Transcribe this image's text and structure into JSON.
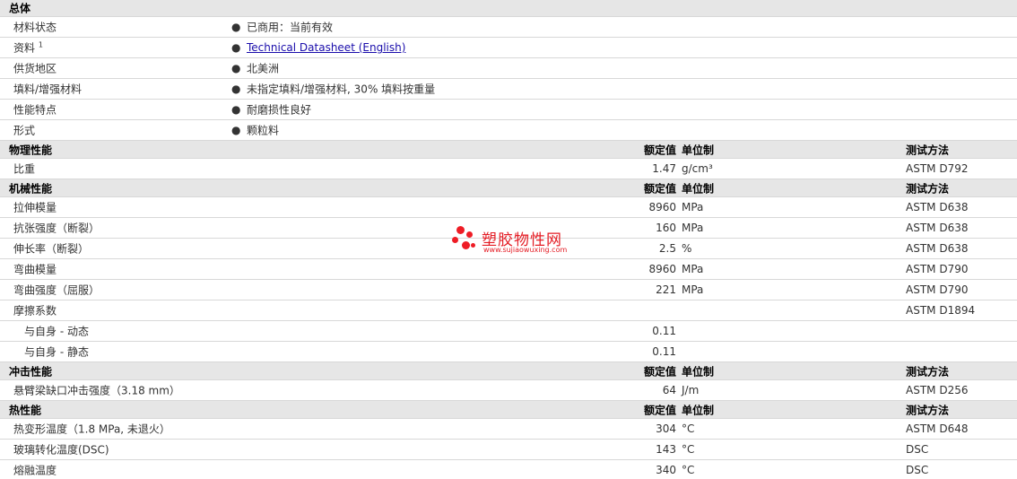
{
  "general": {
    "title": "总体",
    "rows": [
      {
        "label": "材料状态",
        "value": "已商用：当前有效"
      },
      {
        "label": "资料",
        "sup": "1",
        "value": "Technical Datasheet (English)"
      },
      {
        "label": "供货地区",
        "value": "北美洲"
      },
      {
        "label": "填料/增强材料",
        "value": "未指定填料/增强材料, 30% 填料按重量"
      },
      {
        "label": "性能特点",
        "value": "耐磨损性良好"
      },
      {
        "label": "形式",
        "value": "颗粒料"
      }
    ]
  },
  "columns": {
    "nominal": "额定值",
    "unit": "单位制",
    "method": "测试方法"
  },
  "physical": {
    "title": "物理性能",
    "rows": [
      {
        "label": "比重",
        "value": "1.47",
        "unit": "g/cm³",
        "method": "ASTM D792"
      }
    ]
  },
  "mechanical": {
    "title": "机械性能",
    "rows": [
      {
        "label": "拉伸模量",
        "value": "8960",
        "unit": "MPa",
        "method": "ASTM D638"
      },
      {
        "label": "抗张强度（断裂）",
        "value": "160",
        "unit": "MPa",
        "method": "ASTM D638"
      },
      {
        "label": "伸长率（断裂）",
        "value": "2.5",
        "unit": "%",
        "method": "ASTM D638"
      },
      {
        "label": "弯曲模量",
        "value": "8960",
        "unit": "MPa",
        "method": "ASTM D790"
      },
      {
        "label": "弯曲强度（屈服）",
        "value": "221",
        "unit": "MPa",
        "method": "ASTM D790"
      },
      {
        "label": "摩擦系数",
        "value": "",
        "unit": "",
        "method": "ASTM D1894"
      },
      {
        "label": "与自身 - 动态",
        "value": "0.11",
        "unit": "",
        "method": ""
      },
      {
        "label": "与自身 - 静态",
        "value": "0.11",
        "unit": "",
        "method": ""
      }
    ]
  },
  "impact": {
    "title": "冲击性能",
    "rows": [
      {
        "label": "悬臂梁缺口冲击强度（3.18 mm）",
        "value": "64",
        "unit": "J/m",
        "method": "ASTM D256"
      }
    ]
  },
  "thermal": {
    "title": "热性能",
    "rows": [
      {
        "label": "热变形温度（1.8 MPa, 未退火）",
        "value": "304",
        "unit": "°C",
        "method": "ASTM D648"
      },
      {
        "label": "玻璃转化温度(DSC)",
        "value": "143",
        "unit": "°C",
        "method": "DSC"
      },
      {
        "label": "熔融温度",
        "value": "340",
        "unit": "°C",
        "method": "DSC"
      }
    ]
  },
  "watermark": {
    "title": "塑胶物性网",
    "url": "www.sujiaowuxing.com",
    "color": "#e41c24"
  }
}
